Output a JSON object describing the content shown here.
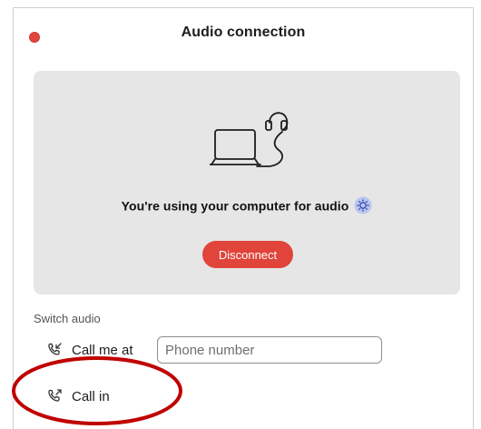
{
  "window": {
    "title": "Audio connection",
    "close_color": "#e0443e"
  },
  "panel": {
    "background": "#e6e6e7",
    "illustration_icon": "laptop-with-headset-icon",
    "message": "You're using your computer for audio",
    "settings_icon": "gear-icon",
    "disconnect_label": "Disconnect",
    "disconnect_color": "#e0443a"
  },
  "switch_audio": {
    "section_label": "Switch audio",
    "call_me": {
      "icon": "phone-incoming-icon",
      "label": "Call me at",
      "placeholder": "Phone number",
      "value": ""
    },
    "call_in": {
      "icon": "phone-outgoing-icon",
      "label": "Call in"
    }
  },
  "annotation": {
    "shape": "ellipse",
    "target": "call_in",
    "color": "#c00000"
  }
}
